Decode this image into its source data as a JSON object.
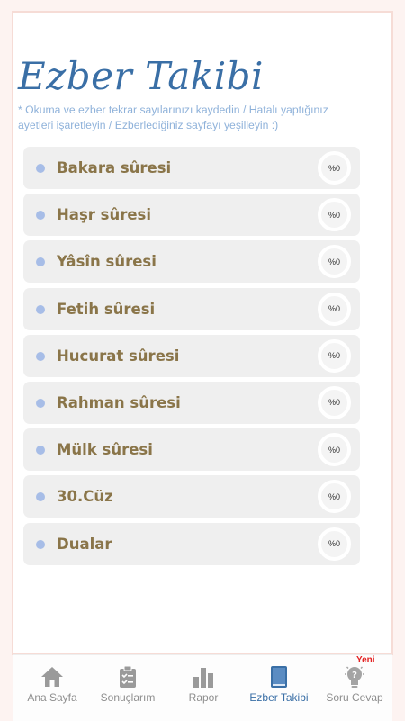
{
  "header": {
    "title": "Ezber Takibi",
    "subtitle": "* Okuma ve ezber tekrar sayılarınızı kaydedin / Hatalı yaptığınız ayetleri işaretleyin / Ezberlediğiniz sayfayı yeşilleyin :)"
  },
  "surahs": [
    {
      "label": "Bakara sûresi",
      "percent": "%0"
    },
    {
      "label": "Haşr sûresi",
      "percent": "%0"
    },
    {
      "label": "Yâsîn sûresi",
      "percent": "%0"
    },
    {
      "label": "Fetih sûresi",
      "percent": "%0"
    },
    {
      "label": "Hucurat sûresi",
      "percent": "%0"
    },
    {
      "label": "Rahman sûresi",
      "percent": "%0"
    },
    {
      "label": "Mülk sûresi",
      "percent": "%0"
    },
    {
      "label": "30.Cüz",
      "percent": "%0"
    },
    {
      "label": "Dualar",
      "percent": "%0"
    }
  ],
  "tabs": [
    {
      "label": "Ana Sayfa",
      "icon": "home-icon"
    },
    {
      "label": "Sonuçlarım",
      "icon": "clipboard-icon"
    },
    {
      "label": "Rapor",
      "icon": "bar-chart-icon"
    },
    {
      "label": "Ezber Takibi",
      "icon": "book-icon"
    },
    {
      "label": "Soru Cevap",
      "icon": "lightbulb-icon"
    }
  ],
  "new_badge": "Yeni",
  "colors": {
    "accent": "#3a6fa6",
    "item_text": "#8a7549",
    "bullet": "#a7bde7",
    "row_bg": "#efefef",
    "badge": "#e32222"
  }
}
